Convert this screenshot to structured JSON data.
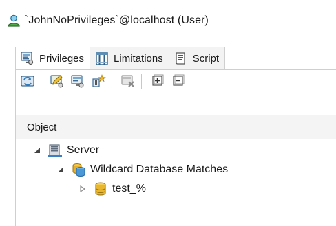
{
  "title": {
    "text": "`JohnNoPrivileges`@localhost (User)",
    "icon": "user-icon"
  },
  "tabs": [
    {
      "label": "Privileges",
      "icon": "privileges-icon",
      "active": true
    },
    {
      "label": "Limitations",
      "icon": "limitations-icon",
      "active": false
    },
    {
      "label": "Script",
      "icon": "script-icon",
      "active": false
    }
  ],
  "toolbar": {
    "buttons": [
      {
        "name": "refresh-icon"
      },
      {
        "name": "grant-icon"
      },
      {
        "name": "grant-all-icon"
      },
      {
        "name": "add-privilege-icon"
      },
      {
        "name": "revoke-icon"
      },
      {
        "name": "expand-all-icon"
      },
      {
        "name": "collapse-all-icon"
      }
    ]
  },
  "grid": {
    "header": "Object",
    "rows": [
      {
        "label": "Server",
        "icon": "server-icon",
        "expanded": true
      },
      {
        "label": "Wildcard Database Matches",
        "icon": "database-group-icon",
        "expanded": true
      },
      {
        "label": "test_%",
        "icon": "database-icon",
        "expanded": false
      }
    ]
  },
  "colors": {
    "accent": "#d19a12",
    "border": "#cfcfcf"
  }
}
